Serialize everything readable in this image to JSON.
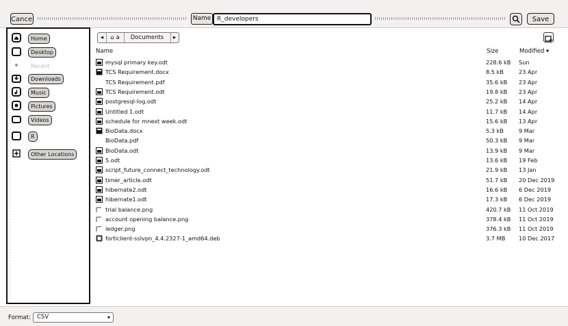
{
  "header": {
    "cancel_label": "Cancel",
    "name_label": "Name",
    "filename_value": "R_developers",
    "save_label": "Save"
  },
  "sidebar": {
    "items": [
      {
        "label": "Home",
        "icon": "home-icon"
      },
      {
        "label": "Desktop",
        "icon": "desktop-icon"
      },
      {
        "label": "Recent",
        "icon": "recent-icon"
      },
      {
        "label": "Downloads",
        "icon": "downloads-icon"
      },
      {
        "label": "Music",
        "icon": "music-icon"
      },
      {
        "label": "Pictures",
        "icon": "pictures-icon"
      },
      {
        "label": "Videos",
        "icon": "videos-icon"
      },
      {
        "label": "R",
        "icon": "folder-icon"
      },
      {
        "label": "Other Locations",
        "icon": "plus-icon"
      }
    ]
  },
  "pathbar": {
    "home_label": "a",
    "current_label": "Documents"
  },
  "columns": {
    "name": "Name",
    "size": "Size",
    "modified": "Modified"
  },
  "files": [
    {
      "name": "mysql primary key.odt",
      "size": "228.6 kB",
      "date": "Sun",
      "icon": "odt-document-icon"
    },
    {
      "name": "TCS Requirement.docx",
      "size": "8.5 kB",
      "date": "23 Apr",
      "icon": "docx-document-icon"
    },
    {
      "name": "TCS Requirement.pdf",
      "size": "35.6 kB",
      "date": "23 Apr",
      "icon": "none"
    },
    {
      "name": "TCS Requirement.odt",
      "size": "19.8 kB",
      "date": "23 Apr",
      "icon": "odt-document-icon"
    },
    {
      "name": "postgresql-log.odt",
      "size": "25.2 kB",
      "date": "14 Apr",
      "icon": "odt-document-icon"
    },
    {
      "name": "Untitled 1.odt",
      "size": "11.7 kB",
      "date": "14 Apr",
      "icon": "odt-document-icon"
    },
    {
      "name": "schedule for mnext week.odt",
      "size": "15.6 kB",
      "date": "13 Apr",
      "icon": "odt-document-icon"
    },
    {
      "name": "BioData.docx",
      "size": "5.3 kB",
      "date": "9 Mar",
      "icon": "docx-document-icon"
    },
    {
      "name": "BioData.pdf",
      "size": "50.3 kB",
      "date": "9 Mar",
      "icon": "none"
    },
    {
      "name": "BioData.odt",
      "size": "13.9 kB",
      "date": "9 Mar",
      "icon": "odt-document-icon"
    },
    {
      "name": "5.odt",
      "size": "13.6 kB",
      "date": "19 Feb",
      "icon": "odt-document-icon"
    },
    {
      "name": "script_future_connect_technology.odt",
      "size": "21.9 kB",
      "date": "13 Jan",
      "icon": "odt-document-icon"
    },
    {
      "name": "timer_article.odt",
      "size": "51.7 kB",
      "date": "20 Dec 2019",
      "icon": "odt-document-icon"
    },
    {
      "name": "hibernate2.odt",
      "size": "16.6 kB",
      "date": "6 Dec 2019",
      "icon": "odt-document-icon"
    },
    {
      "name": "hibernate1.odt",
      "size": "17.3 kB",
      "date": "6 Dec 2019",
      "icon": "odt-document-icon"
    },
    {
      "name": "trial balance.png",
      "size": "420.7 kB",
      "date": "11 Oct 2019",
      "icon": "image-file-icon"
    },
    {
      "name": "account opening balance.png",
      "size": "378.4 kB",
      "date": "11 Oct 2019",
      "icon": "image-file-icon"
    },
    {
      "name": "ledger.png",
      "size": "376.3 kB",
      "date": "11 Oct 2019",
      "icon": "image-file-icon"
    },
    {
      "name": "forticlient-sslvpn_4.4.2327-1_amd64.deb",
      "size": "3.7 MB",
      "date": "10 Dec 2017",
      "icon": "package-icon"
    }
  ],
  "footer": {
    "format_label": "Format:",
    "format_value": "CSV"
  }
}
